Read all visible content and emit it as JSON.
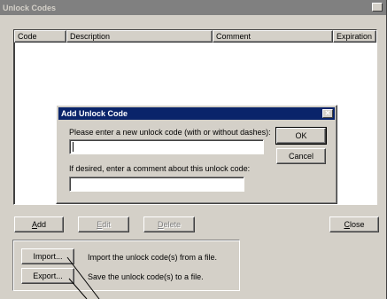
{
  "main_window": {
    "title": "Unlock Codes",
    "close_glyph": "✕",
    "columns": [
      "Code",
      "Description",
      "Comment",
      "Expiration"
    ],
    "buttons": {
      "add_key": "A",
      "add_rest": "dd",
      "edit_key": "E",
      "edit_rest": "dit",
      "delete_key": "D",
      "delete_rest": "elete",
      "close_key": "C",
      "close_rest": "lose"
    },
    "import_button": "Import...",
    "import_desc": "Import the unlock code(s) from a file.",
    "export_button": "Export...",
    "export_desc": "Save the unlock code(s) to a file."
  },
  "dialog": {
    "title": "Add Unlock Code",
    "close_glyph": "✕",
    "code_prompt": "Please enter a new unlock code (with or without dashes):",
    "code_value": "",
    "comment_prompt": "If desired, enter a comment about this unlock code:",
    "comment_value": "",
    "ok_label": "OK",
    "cancel_label": "Cancel"
  },
  "colors": {
    "inactive_title": "#808080",
    "active_title": "#0a246a",
    "face": "#d4d0c8"
  }
}
